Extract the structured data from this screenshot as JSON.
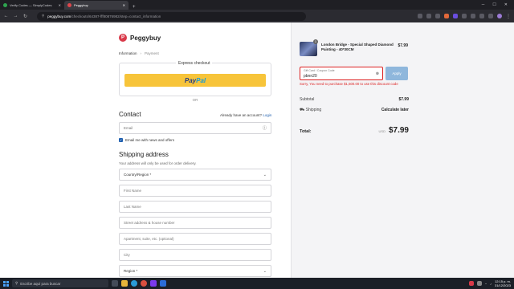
{
  "browser": {
    "tabs": [
      {
        "label": "Verify Codes — SimplyCodes",
        "favicon_color": "#2ea44f"
      },
      {
        "label": "Peggybuy",
        "favicon_color": "#e0474c"
      }
    ],
    "new_tab": "+",
    "url_host": "peggybuy.com",
    "url_path": "/checkouts/64387-fff80876982/step=contact_information"
  },
  "brand": {
    "logo_letter": "P",
    "name": "Peggybuy"
  },
  "breadcrumb": {
    "step1": "Information",
    "sep": "›",
    "step2": "Payment"
  },
  "express": {
    "label": "Express checkout",
    "paypal_a": "Pay",
    "paypal_b": "Pal",
    "or": "OR"
  },
  "contact": {
    "title": "Contact",
    "account_prompt": "Already have an account?",
    "login": "Login",
    "email_placeholder": "Email",
    "newsletter": "Email me with news and offers"
  },
  "shipping": {
    "title": "Shipping address",
    "subtitle": "Your address will only be used for order delivery.",
    "country": "Country/Region *",
    "first": "First Name",
    "last": "Last Name",
    "street": "Street address & house number",
    "apt": "Apartment, suite, etc. (optional)",
    "city": "City",
    "region": "Region *"
  },
  "summary": {
    "product": {
      "name": "London Bridge - Special Shaped Diamond Painting - 40*30CM",
      "price": "$7.99",
      "qty": "1"
    },
    "coupon": {
      "label": "Gift Card / Coupon Code",
      "value": "pbnn20",
      "apply": "Apply"
    },
    "error": "Sorry, You need to purchase $1,500.00 to use this discount code",
    "subtotal_label": "Subtotal",
    "subtotal": "$7.99",
    "shipping_label": "Shipping",
    "shipping": "Calculate later",
    "total_label": "Total:",
    "currency": "USD",
    "total": "$7.99"
  },
  "taskbar": {
    "search": "Escribe aquí para buscar",
    "time": "12:15 p. m.",
    "date": "31/12/2023"
  }
}
